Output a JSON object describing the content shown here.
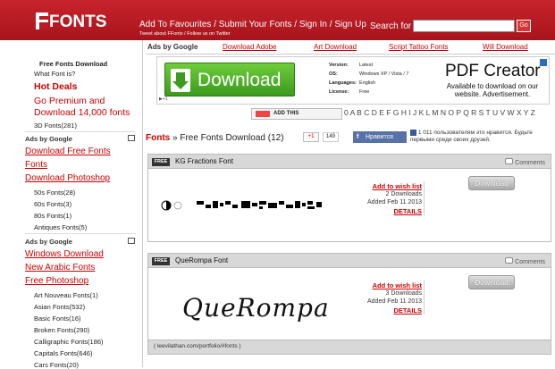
{
  "header": {
    "logo": "FONTS",
    "nav": [
      "Add To Favourites",
      "Submit Your Fonts",
      "Sign In",
      "Sign Up"
    ],
    "tagline": "Tweet about FFonts / Follow us on Twitter",
    "search_label": "Search for",
    "search_value": "",
    "go_label": "Go"
  },
  "sidebar": {
    "free_fonts_download": "Free Fonts Download",
    "what_font": "What Font is?",
    "hot_deals": "Hot Deals",
    "premium": "Go Premium and Download 14,000 fonts",
    "fonts3d": "3D Fonts(281)",
    "ads1": "Ads by Google",
    "ad_links1": [
      "Download Free Fonts",
      "Fonts",
      "Download Photoshop"
    ],
    "cats1": [
      "50s Fonts(28)",
      "60s Fonts(3)",
      "80s Fonts(1)",
      "Antiques Fonts(5)"
    ],
    "ads2": "Ads by Google",
    "ad_links2": [
      "Windows Download",
      "New Arabic Fonts",
      "Free Photoshop"
    ],
    "cats2": [
      "Art Nouveau Fonts(1)",
      "Asian Fonts(532)",
      "Basic Fonts(16)",
      "Broken Fonts(290)",
      "Calligraphic Fonts(186)",
      "Capitals Fonts(646)",
      "Cars Fonts(20)"
    ]
  },
  "ad_row": {
    "label": "Ads by Google",
    "links": [
      "Download Adobe",
      "Art Download",
      "Script Tattoo Fonts",
      "Will Download"
    ]
  },
  "banner": {
    "download": "Download",
    "specs": [
      {
        "k": "Version:",
        "v": "Latest"
      },
      {
        "k": "OS:",
        "v": "Windows XP / Vista / 7"
      },
      {
        "k": "Languages:",
        "v": "English"
      },
      {
        "k": "License:",
        "v": "Free"
      }
    ],
    "pdf_title": "PDF Creator",
    "pdf_sub": "Available to download on our website. Advertisement."
  },
  "alpha": {
    "addthis": "ADD THIS",
    "letters": "0 A B C D E F G H I J K L M N O P Q R S T U V W X Y Z"
  },
  "crumbs": {
    "fonts": "Fonts",
    "sep": "»",
    "current": "Free Fonts Download",
    "count": "(12)"
  },
  "social": {
    "plus1": "+1",
    "count": "149",
    "like": "Нравится",
    "vk_text": "1 011 пользователям это нравится. Будьте первыми среди своих друзей."
  },
  "cards": [
    {
      "tag": "FREE",
      "title": "KG Fractions Font",
      "comments": "Comments",
      "wish": "Add to wish list",
      "downloads": "2 Downloads",
      "added": "Added Feb 11 2013",
      "details": "DETAILS",
      "button": "Download"
    },
    {
      "tag": "FREE",
      "title": "QueRompa Font",
      "comments": "Comments",
      "wish": "Add to wish list",
      "downloads": "3 Downloads",
      "added": "Added Feb 11 2013",
      "details": "DETAILS",
      "button": "Download",
      "preview": "QueRompa",
      "credit": "( leevilathan.com/portfolio/#fonts )"
    }
  ]
}
